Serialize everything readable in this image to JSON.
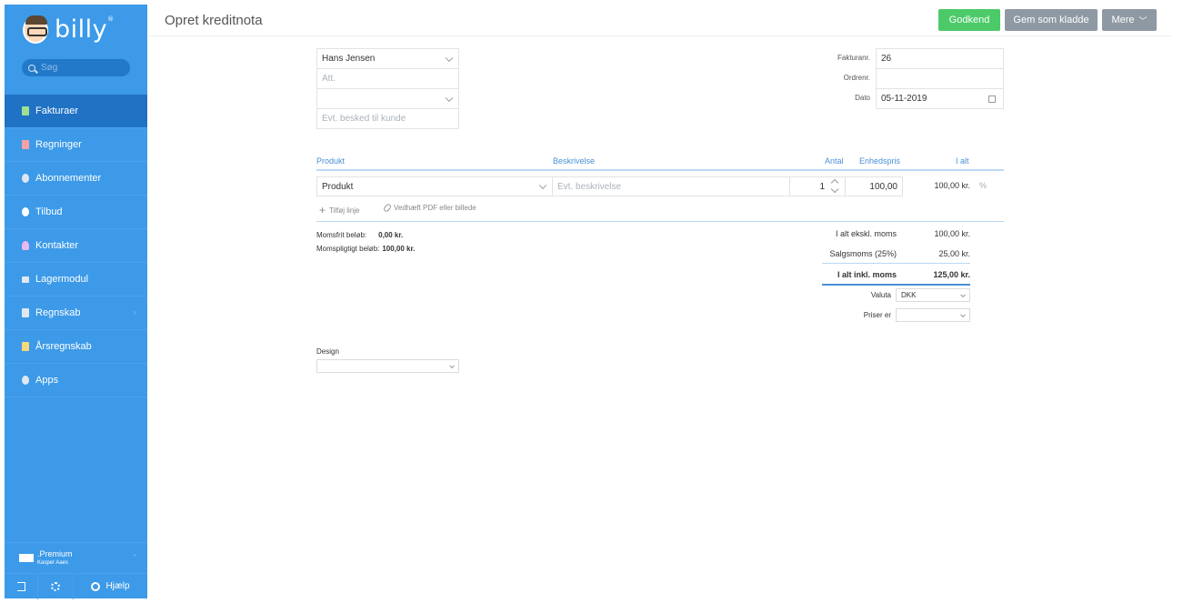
{
  "app": {
    "logo": "billy",
    "logo_mark": "®"
  },
  "search": {
    "placeholder": "Søg"
  },
  "sidebar": {
    "items": [
      {
        "label": "Fakturaer",
        "icon": "invoice-icon",
        "color": "#9fe08e"
      },
      {
        "label": "Regninger",
        "icon": "bill-icon",
        "color": "#f7a3a3"
      },
      {
        "label": "Abonnementer",
        "icon": "subscription-icon",
        "color": "#dfe8f2"
      },
      {
        "label": "Tilbud",
        "icon": "offer-icon",
        "color": "#ffffff"
      },
      {
        "label": "Kontakter",
        "icon": "contacts-icon",
        "color": "#e8b8f0"
      },
      {
        "label": "Lagermodul",
        "icon": "inventory-icon",
        "color": "#dfe8f2"
      },
      {
        "label": "Regnskab",
        "icon": "accounting-icon",
        "color": "#dfe8f2"
      },
      {
        "label": "Årsregnskab",
        "icon": "annual-report-icon",
        "color": "#f7d87a"
      },
      {
        "label": "Apps",
        "icon": "apps-icon",
        "color": "#dfe8f2"
      }
    ],
    "premium": {
      "label": "Premium",
      "prefix": ".",
      "user": "Kasper Aaes"
    },
    "help_label": "Hjælp"
  },
  "header": {
    "title": "Opret kreditnota",
    "approve": "Godkend",
    "save_draft": "Gem som kladde",
    "more": "Mere"
  },
  "customer": {
    "contact": "Hans Jensen",
    "att_placeholder": "Att.",
    "third": "",
    "message_placeholder": "Evt. besked til kunde"
  },
  "meta": {
    "invoice_no_label": "Fakturanr.",
    "invoice_no": "26",
    "order_no_label": "Ordrenr.",
    "order_no": "",
    "date_label": "Dato",
    "date": "05-11-2019"
  },
  "lines": {
    "headers": {
      "product": "Produkt",
      "description": "Beskrivelse",
      "qty": "Antal",
      "unit_price": "Enhedspris",
      "total": "I alt"
    },
    "row": {
      "product": "Produkt",
      "description_placeholder": "Evt. beskrivelse",
      "qty": "1",
      "unit_price": "100,00",
      "total": "100,00 kr.",
      "percent": "%"
    },
    "add_line": "Tilføj linje",
    "attach": "Vedhæft PDF eller billede"
  },
  "summary": {
    "vat_free_label": "Momsfrit beløb:",
    "vat_free": "0,00 kr.",
    "vat_liable_label": "Momspligtigt beløb:",
    "vat_liable": "100,00 kr.",
    "excl_label": "I alt ekskl. moms",
    "excl": "100,00 kr.",
    "vat_label": "Salgsmoms (25%)",
    "vat": "25,00 kr.",
    "incl_label": "I alt inkl. moms",
    "incl": "125,00 kr.",
    "currency_label": "Valuta",
    "currency": "DKK",
    "prices_label": "Priser er",
    "prices": ""
  },
  "design": {
    "label": "Design",
    "value": ""
  },
  "colors": {
    "sidebar": "#3c9ae8",
    "active": "#1f72c4",
    "approve": "#4cca69",
    "secondary": "#8e99a4",
    "accent": "#4a8fd6"
  }
}
